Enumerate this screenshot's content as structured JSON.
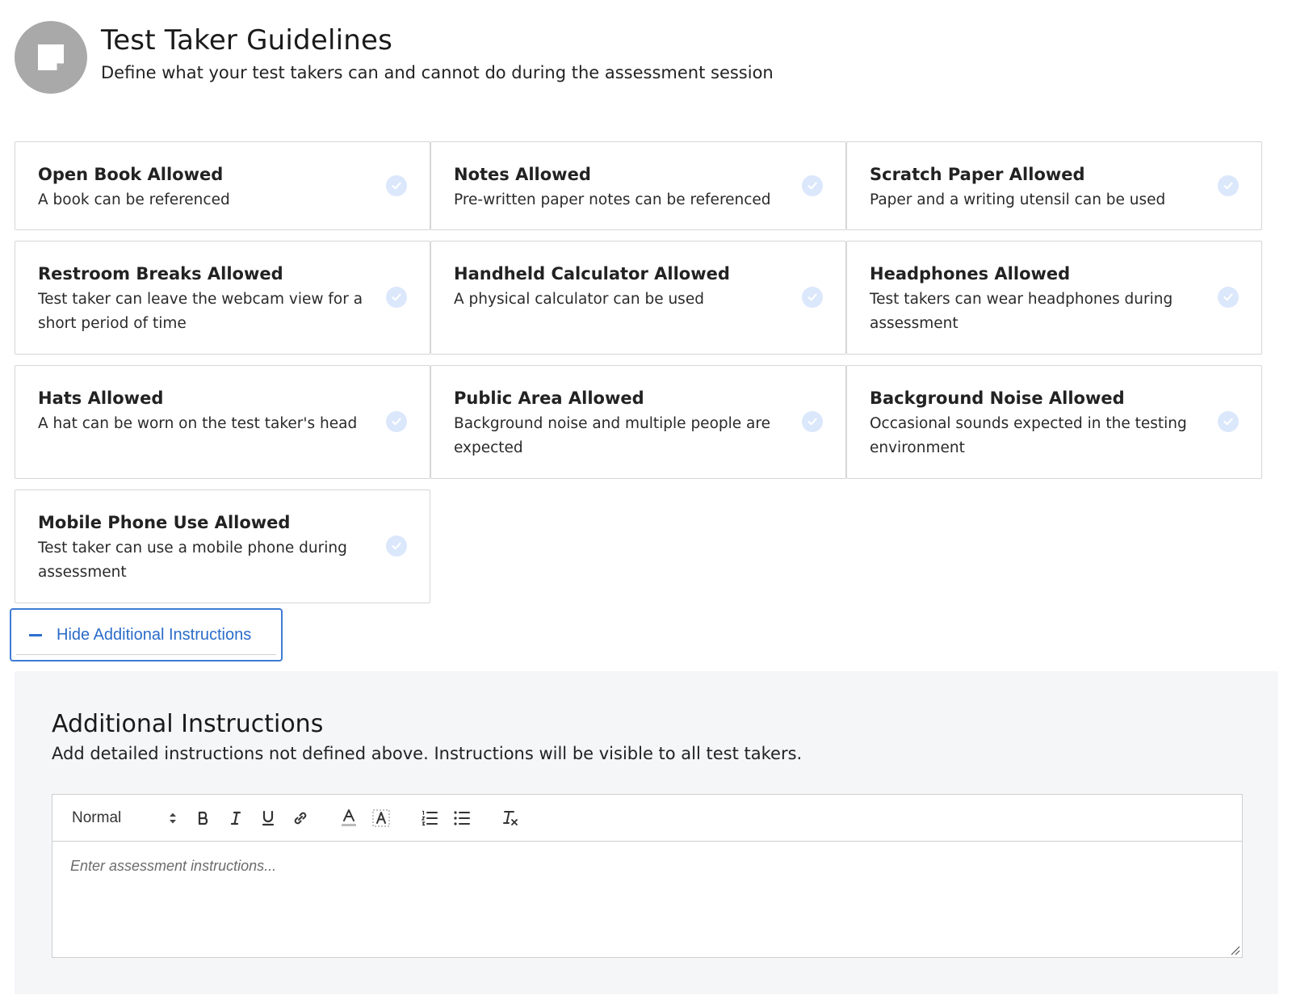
{
  "header": {
    "icon": "sticky-note-icon",
    "title": "Test Taker Guidelines",
    "subtitle": "Define what your test takers can and cannot do during the assessment session"
  },
  "guidelines": [
    {
      "title": "Open Book Allowed",
      "description": "A book can be referenced",
      "checked": true
    },
    {
      "title": "Notes Allowed",
      "description": "Pre-written paper notes can be referenced",
      "checked": true
    },
    {
      "title": "Scratch Paper Allowed",
      "description": "Paper and a writing utensil can be used",
      "checked": true
    },
    {
      "title": "Restroom Breaks Allowed",
      "description": "Test taker can leave the webcam view for a short period of time",
      "checked": true
    },
    {
      "title": "Handheld Calculator Allowed",
      "description": "A physical calculator can be used",
      "checked": true
    },
    {
      "title": "Headphones Allowed",
      "description": "Test takers can wear headphones during assessment",
      "checked": true
    },
    {
      "title": "Hats Allowed",
      "description": "A hat can be worn on the test taker's head",
      "checked": true
    },
    {
      "title": "Public Area Allowed",
      "description": "Background noise and multiple people are expected",
      "checked": true
    },
    {
      "title": "Background Noise Allowed",
      "description": "Occasional sounds expected in the testing environment",
      "checked": true
    },
    {
      "title": "Mobile Phone Use Allowed",
      "description": "Test taker can use a mobile phone during assessment",
      "checked": true
    }
  ],
  "toggle": {
    "label": "Hide Additional Instructions"
  },
  "additional": {
    "title": "Additional Instructions",
    "description": "Add detailed instructions not defined above. Instructions will be visible to all test takers.",
    "editor": {
      "format_value": "Normal",
      "placeholder": "Enter assessment instructions...",
      "toolbar_icons": [
        "bold-icon",
        "italic-icon",
        "underline-icon",
        "link-icon",
        "text-color-icon",
        "background-color-icon",
        "ordered-list-icon",
        "bullet-list-icon",
        "clear-format-icon"
      ]
    }
  },
  "colors": {
    "accent": "#2b6cc9",
    "check_bg": "#dbe7fb",
    "panel_bg": "#f5f6f8"
  }
}
